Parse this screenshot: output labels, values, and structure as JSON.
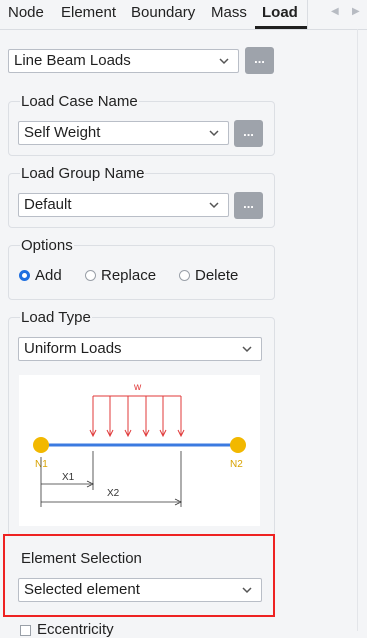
{
  "tabs": [
    {
      "label": "Node"
    },
    {
      "label": "Element"
    },
    {
      "label": "Boundary"
    },
    {
      "label": "Mass"
    },
    {
      "label": "Load"
    }
  ],
  "load_type_select": {
    "value": "Line Beam Loads"
  },
  "more_button_label": "...",
  "load_case": {
    "title": "Load Case Name",
    "value": "Self Weight"
  },
  "load_group": {
    "title": "Load Group Name",
    "value": "Default"
  },
  "options": {
    "title": "Options",
    "items": [
      "Add",
      "Replace",
      "Delete"
    ],
    "selected": "Add"
  },
  "load_type": {
    "title": "Load Type",
    "value": "Uniform Loads"
  },
  "diagram": {
    "w": "w",
    "n1": "N1",
    "n2": "N2",
    "x1": "X1",
    "x2": "X2"
  },
  "element_selection": {
    "title": "Element Selection",
    "value": "Selected element"
  },
  "eccentricity": {
    "label": "Eccentricity"
  },
  "colors": {
    "accent": "#1f6fe0",
    "highlight": "#ee2222",
    "load_arrows": "#e03a3a",
    "beam": "#3b7ae0",
    "node": "#f2b800"
  }
}
